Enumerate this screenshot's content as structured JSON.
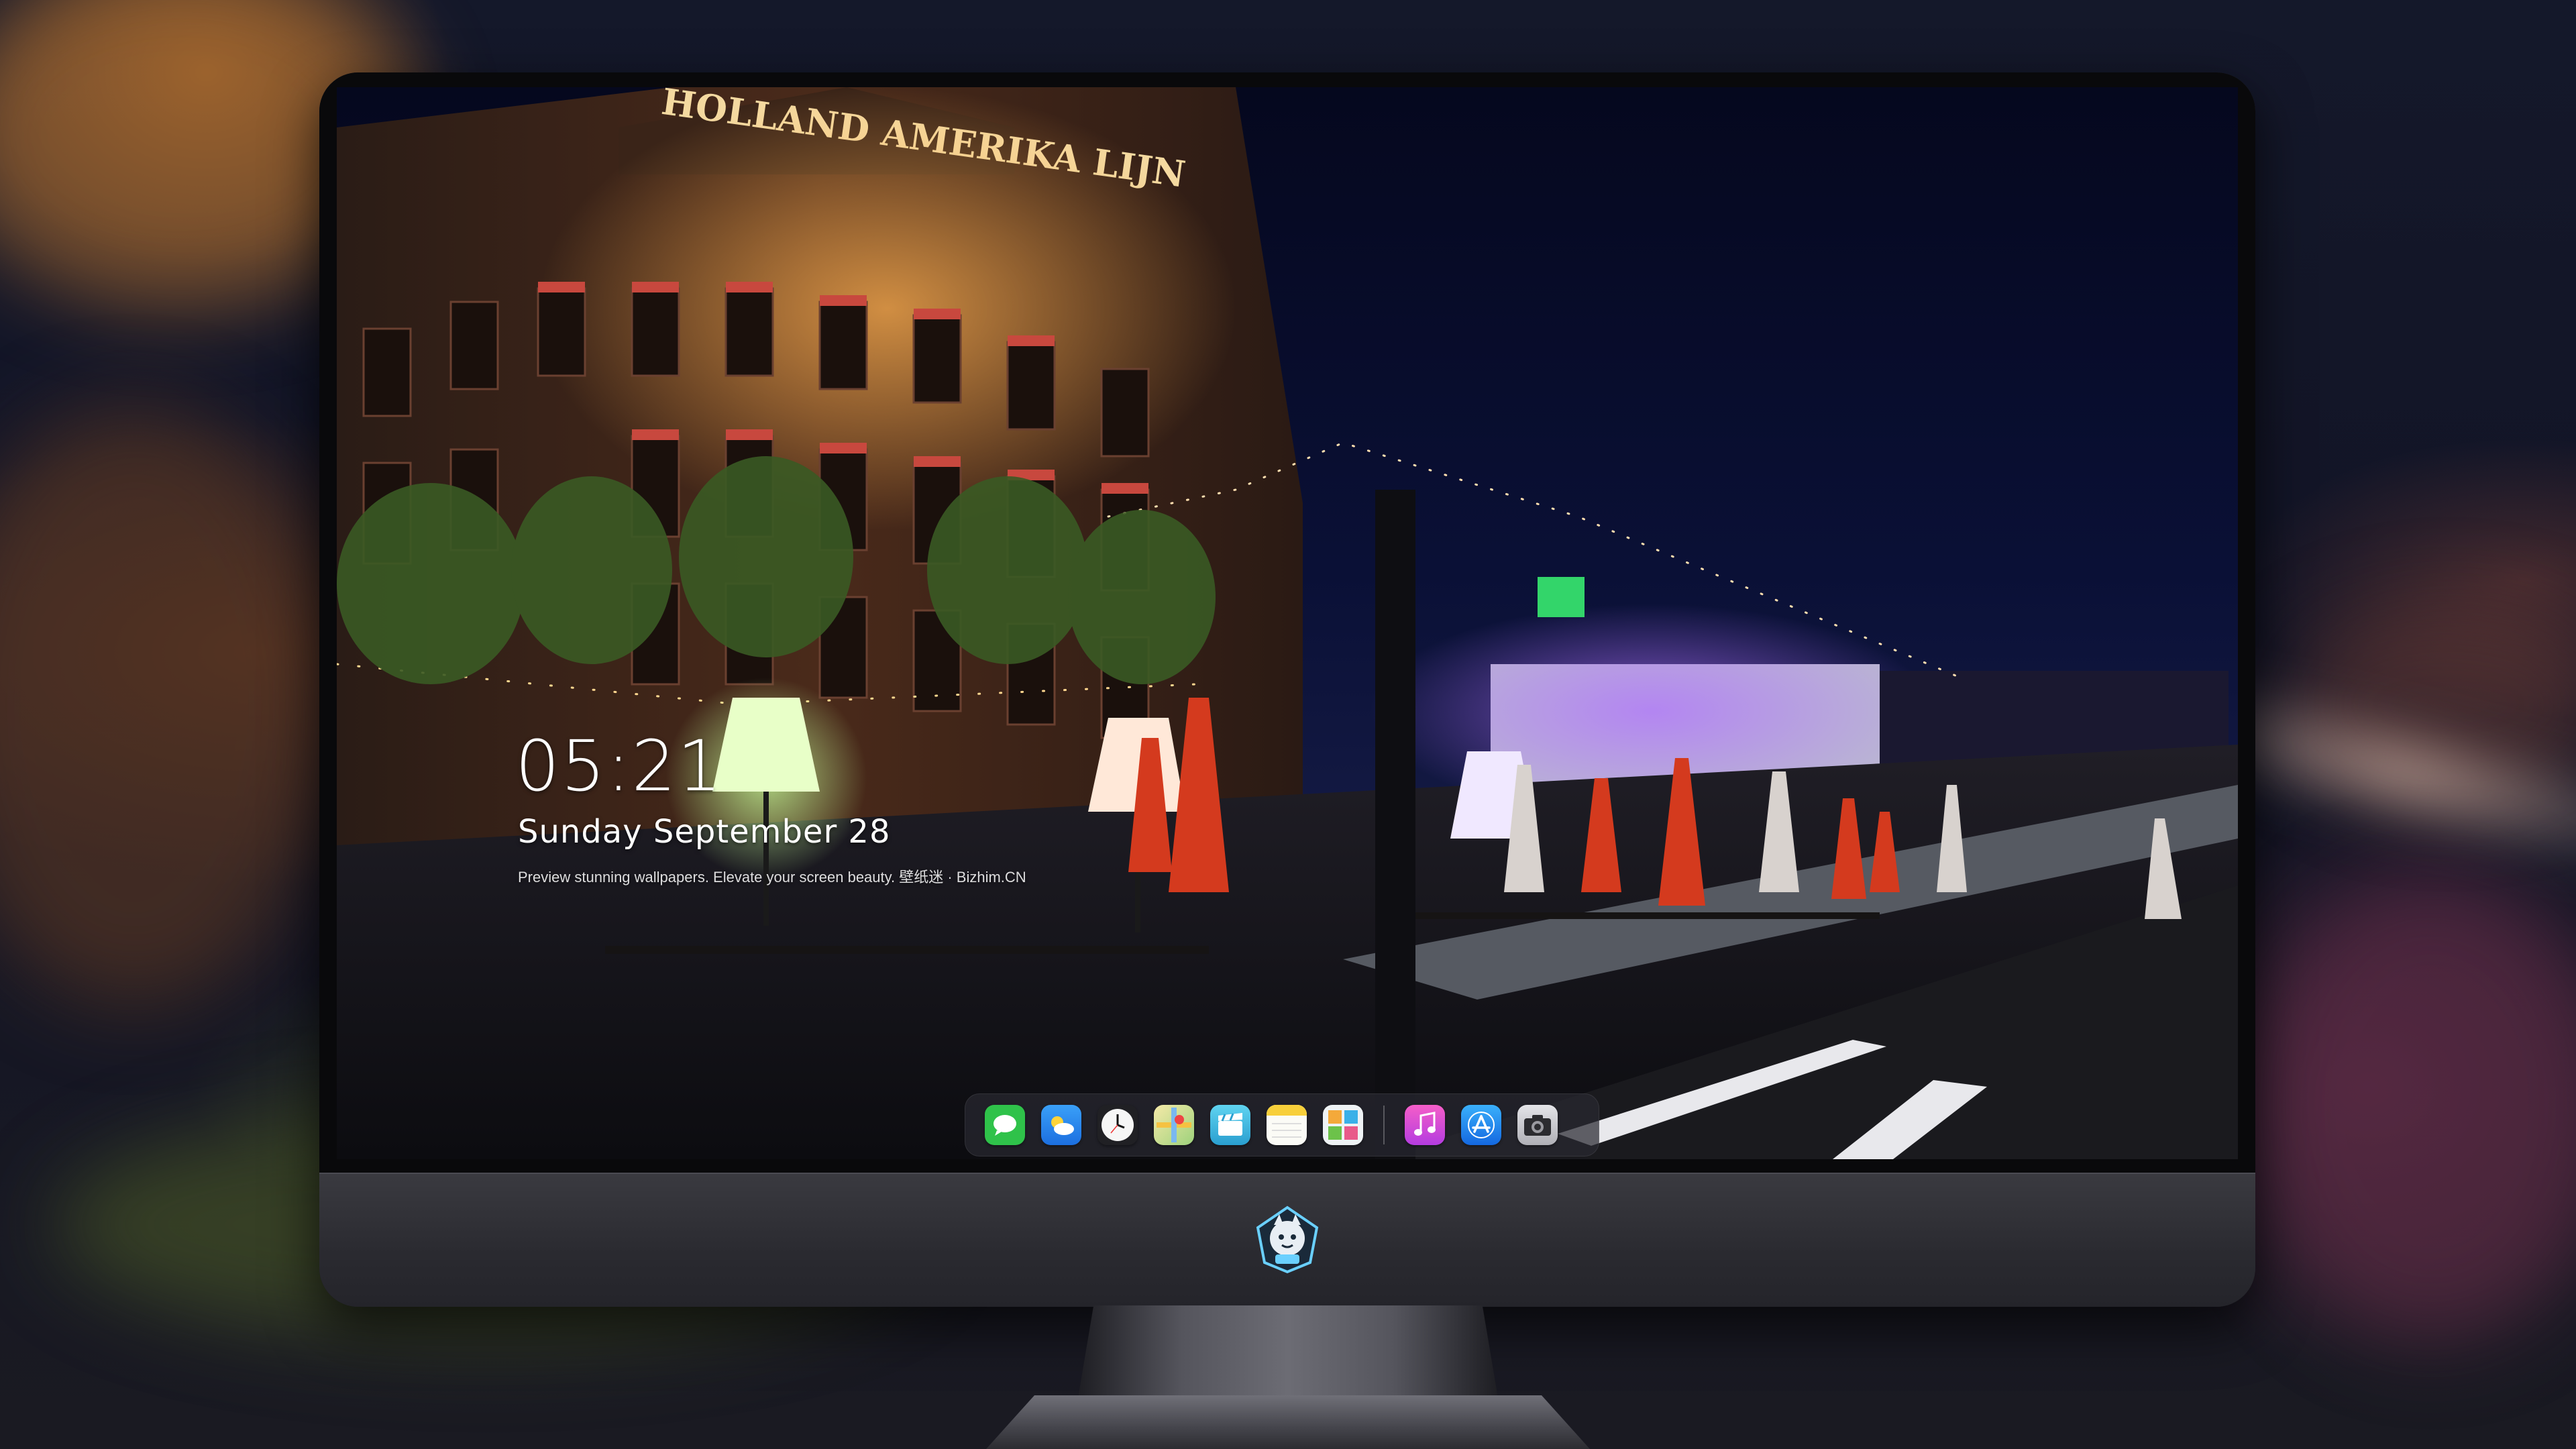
{
  "lockscreen": {
    "time": "05:21",
    "date": "Sunday September  28",
    "caption": "Preview stunning wallpapers. Elevate your screen beauty. 壁纸迷 · Bizhim.CN"
  },
  "wallpaper": {
    "building_sign": "HOLLAND AMERIKA LIJN"
  },
  "dock": {
    "apps": [
      {
        "name": "Messages",
        "icon": "messages-icon",
        "color": "#2fc24a"
      },
      {
        "name": "Weather",
        "icon": "weather-icon",
        "color": "#2f8ef5"
      },
      {
        "name": "Clock",
        "icon": "clock-icon",
        "color": "#f2f2f2"
      },
      {
        "name": "Maps",
        "icon": "maps-icon",
        "color": "#f2d24a"
      },
      {
        "name": "Clips",
        "icon": "clips-icon",
        "color": "#3fbfe0"
      },
      {
        "name": "Notes",
        "icon": "notes-icon",
        "color": "#f7f7f2"
      },
      {
        "name": "Photos",
        "icon": "photos-icon",
        "color": "#e9eef2"
      },
      {
        "name": "Music",
        "icon": "music-icon",
        "color": "#e64bd0"
      },
      {
        "name": "App Store",
        "icon": "app-store-icon",
        "color": "#1d8cf8"
      },
      {
        "name": "Camera",
        "icon": "camera-icon",
        "color": "#d9d9dd"
      }
    ]
  },
  "monitor": {
    "chin_logo": "mascot-logo-icon"
  }
}
